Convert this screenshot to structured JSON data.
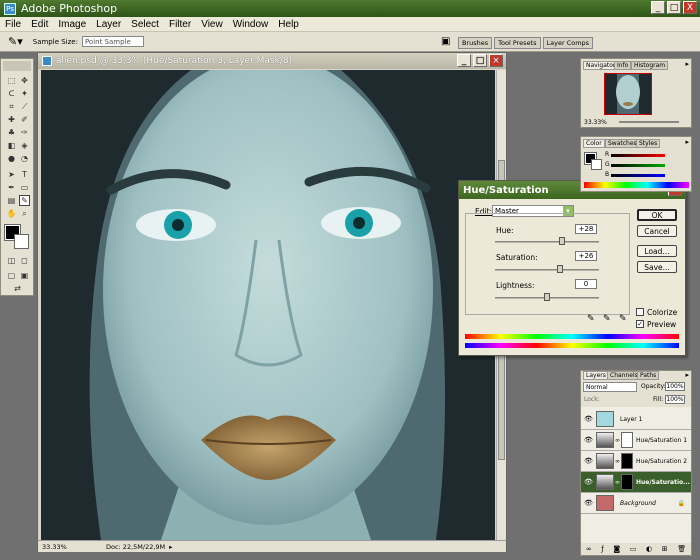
{
  "app": {
    "title": "Adobe Photoshop",
    "window_controls": [
      "_",
      "□",
      "X"
    ]
  },
  "menu": [
    "File",
    "Edit",
    "Image",
    "Layer",
    "Select",
    "Filter",
    "View",
    "Window",
    "Help"
  ],
  "options_bar": {
    "sample_size_label": "Sample Size:",
    "sample_size_value": "Point Sample",
    "dock_tabs": [
      "Brushes",
      "Tool Presets",
      "Layer Comps"
    ]
  },
  "document": {
    "title": "alien.psd @ 33,3% (Hue/Saturation 3, Layer Mask/8)",
    "zoom": "33.33%",
    "doc_size": "Doc: 22,5M/22,9M"
  },
  "hue_saturation": {
    "title": "Hue/Saturation",
    "edit_label": "Edit:",
    "edit_value": "Master",
    "hue_label": "Hue:",
    "hue_value": "+28",
    "hue_level": 0.58,
    "saturation_label": "Saturation:",
    "saturation_value": "+26",
    "saturation_level": 0.56,
    "lightness_label": "Lightness:",
    "lightness_value": "0",
    "lightness_level": 0.5,
    "ok_label": "OK",
    "cancel_label": "Cancel",
    "load_label": "Load...",
    "save_label": "Save...",
    "colorize_label": "Colorize",
    "colorize_checked": false,
    "preview_label": "Preview",
    "preview_checked": true
  },
  "navigator": {
    "tabs": [
      "Navigator",
      "Info",
      "Histogram"
    ],
    "zoom": "33.33%"
  },
  "color_panel": {
    "tabs": [
      "Color",
      "Swatches",
      "Styles"
    ],
    "channels": [
      "R",
      "G",
      "B"
    ]
  },
  "layers_panel": {
    "tabs": [
      "Layers",
      "Channels",
      "Paths"
    ],
    "blend_mode": "Normal",
    "opacity_label": "Opacity:",
    "opacity_value": "100%",
    "lock_label": "Lock:",
    "fill_label": "Fill:",
    "fill_value": "100%",
    "layers": [
      {
        "name": "Layer 1",
        "active": false
      },
      {
        "name": "Hue/Saturation 1",
        "active": false
      },
      {
        "name": "Hue/Saturation 2",
        "active": false
      },
      {
        "name": "Hue/Saturatio...",
        "active": true
      },
      {
        "name": "Background",
        "active": false
      }
    ]
  },
  "colors": {
    "title_bar": "#3c6621",
    "selected_layer": "#3b5f2a",
    "skin_tone": "#9fc0c2",
    "eye_color": "#1aa0a8",
    "lips": "#9a7a4a"
  }
}
